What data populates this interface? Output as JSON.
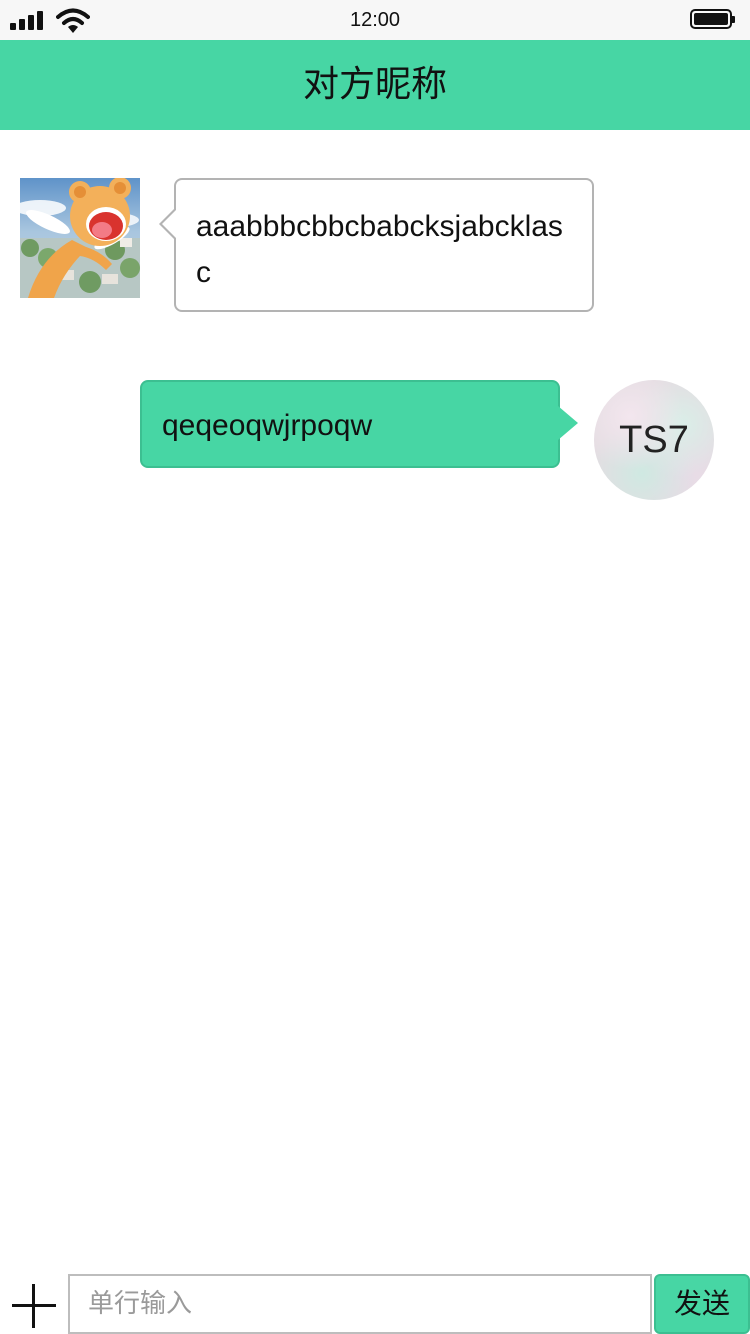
{
  "status_bar": {
    "time": "12:00",
    "icons": [
      "signal-icon",
      "wifi-icon",
      "battery-icon"
    ]
  },
  "header": {
    "title": "对方昵称"
  },
  "messages": [
    {
      "direction": "incoming",
      "avatar": "cartoon-character-avatar",
      "text": "aaabbbcbbcbabcksjabcklasc"
    },
    {
      "direction": "outgoing",
      "avatar_text": "TS7",
      "text": "qeqeoqwjrpoqw"
    }
  ],
  "composer": {
    "add_icon": "plus-icon",
    "placeholder": "单行输入",
    "value": "",
    "send_label": "发送"
  },
  "colors": {
    "accent": "#47d6a4",
    "status_bar_bg": "#f7f7f7",
    "incoming_border": "#b3b3b3"
  }
}
